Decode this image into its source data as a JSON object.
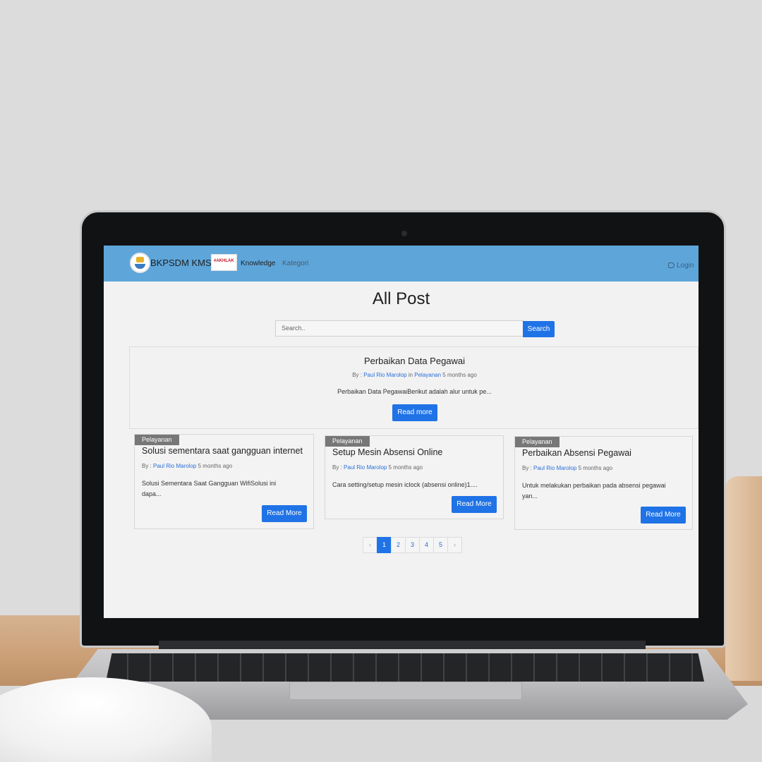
{
  "navbar": {
    "brand": "BKPSDM KMS",
    "badge_text": "#AKHLAK",
    "links": [
      "Knowledge",
      "Kategori"
    ],
    "login_label": "Login"
  },
  "page": {
    "title": "All Post",
    "search": {
      "placeholder": "Search..",
      "button_label": "Search"
    }
  },
  "featured": {
    "title": "Perbaikan Data Pegawai",
    "meta_by": "By : ",
    "author": "Paul Rio Marolop",
    "meta_in": " in ",
    "category": "Pelayanan",
    "time": " 5 months ago",
    "excerpt": "Perbaikan Data PegawaiBerikut adalah alur untuk pe...",
    "button_label": "Read more"
  },
  "posts": [
    {
      "tag": "Pelayanan",
      "title": "Solusi sementara saat gangguan internet",
      "meta_by": "By : ",
      "author": "Paul Rio Marolop",
      "time": " 5 months ago",
      "excerpt": "Solusi Sementara Saat Gangguan WifiSolusi ini dapa...",
      "button_label": "Read More"
    },
    {
      "tag": "Pelayanan",
      "title": "Setup Mesin Absensi Online",
      "meta_by": "By : ",
      "author": "Paul Rio Marolop",
      "time": " 5 months ago",
      "excerpt": "Cara setting/setup mesin iclock (absensi online)1....",
      "button_label": "Read More"
    },
    {
      "tag": "Pelayanan",
      "title": "Perbaikan Absensi Pegawai",
      "meta_by": "By : ",
      "author": "Paul Rio Marolop",
      "time": " 5 months ago",
      "excerpt": "Untuk melakukan perbaikan pada absensi pegawai yan...",
      "button_label": "Read More"
    }
  ],
  "pagination": {
    "prev": "‹",
    "pages": [
      "1",
      "2",
      "3",
      "4",
      "5"
    ],
    "next": "›",
    "active_page": "1"
  }
}
